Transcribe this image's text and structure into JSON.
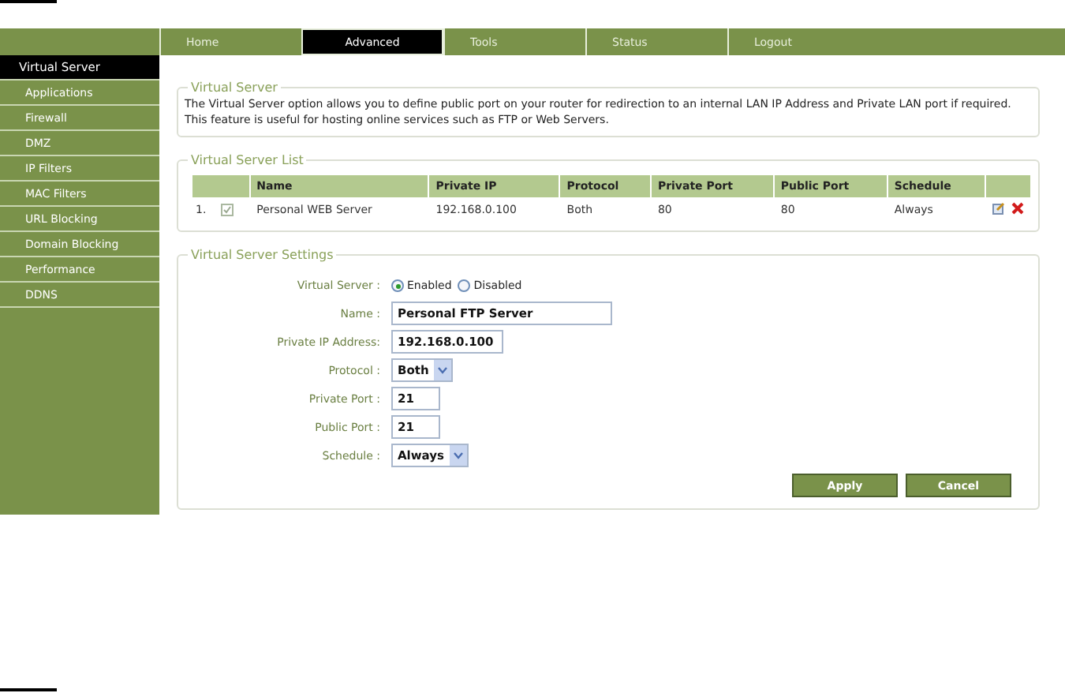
{
  "nav": [
    {
      "label": "Home",
      "selected": false
    },
    {
      "label": "Advanced",
      "selected": true
    },
    {
      "label": "Tools",
      "selected": false
    },
    {
      "label": "Status",
      "selected": false
    },
    {
      "label": "Logout",
      "selected": false
    }
  ],
  "sidebar": {
    "items": [
      {
        "label": "Virtual Server",
        "selected": true
      },
      {
        "label": "Applications",
        "selected": false
      },
      {
        "label": "Firewall",
        "selected": false
      },
      {
        "label": "DMZ",
        "selected": false
      },
      {
        "label": "IP Filters",
        "selected": false
      },
      {
        "label": "MAC Filters",
        "selected": false
      },
      {
        "label": "URL Blocking",
        "selected": false
      },
      {
        "label": "Domain Blocking",
        "selected": false
      },
      {
        "label": "Performance",
        "selected": false
      },
      {
        "label": "DDNS",
        "selected": false
      }
    ]
  },
  "info": {
    "title": "Virtual Server",
    "text": "The Virtual Server option allows you to define public port on your router for redirection to an internal LAN IP Address and Private LAN port if required. This feature is useful for hosting online services such as FTP or Web Servers."
  },
  "list": {
    "title": "Virtual Server List",
    "columns": [
      "Name",
      "Private IP",
      "Protocol",
      "Private Port",
      "Public Port",
      "Schedule"
    ],
    "rows": [
      {
        "index": "1.",
        "checked": true,
        "name": "Personal WEB Server",
        "private_ip": "192.168.0.100",
        "protocol": "Both",
        "private_port": "80",
        "public_port": "80",
        "schedule": "Always"
      }
    ]
  },
  "settings": {
    "title": "Virtual Server Settings",
    "fields": [
      {
        "kind": "radio",
        "label": "Virtual Server :",
        "options": [
          {
            "label": "Enabled",
            "selected": true
          },
          {
            "label": "Disabled",
            "selected": false
          }
        ]
      },
      {
        "kind": "text",
        "label": "Name :",
        "value": "Personal FTP Server"
      },
      {
        "kind": "text",
        "label": "Private IP Address:",
        "value": "192.168.0.100"
      },
      {
        "kind": "select",
        "label": "Protocol :",
        "value": "Both"
      },
      {
        "kind": "text",
        "label": "Private Port :",
        "value": "21"
      },
      {
        "kind": "text",
        "label": "Public Port :",
        "value": "21"
      },
      {
        "kind": "select",
        "label": "Schedule :",
        "value": "Always"
      }
    ]
  },
  "buttons": [
    "Apply",
    "Cancel"
  ]
}
